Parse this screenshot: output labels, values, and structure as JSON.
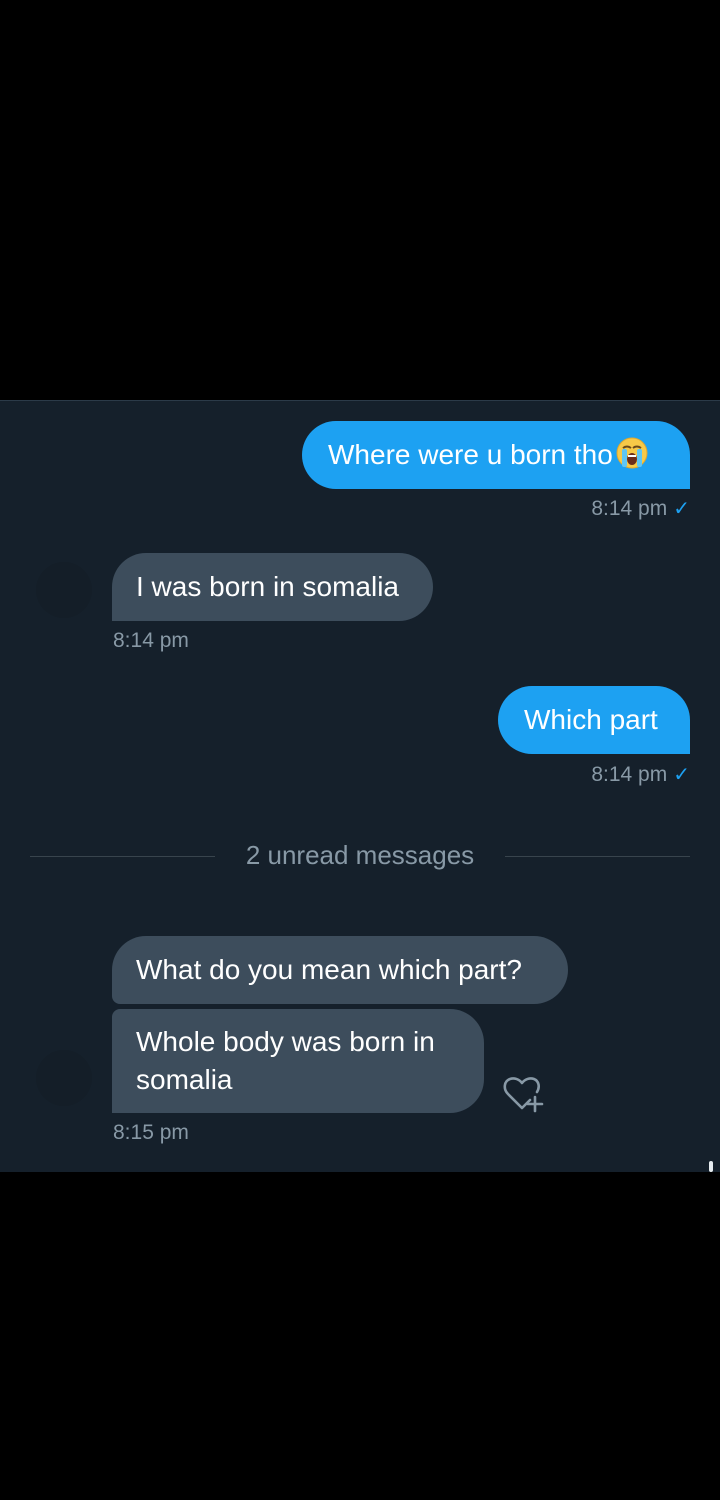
{
  "messages": [
    {
      "direction": "outgoing",
      "text": "Where were u born tho",
      "emoji": "loudly-crying-face",
      "time": "8:14 pm",
      "read": true
    },
    {
      "direction": "incoming",
      "text": "I was born in somalia",
      "time": "8:14 pm"
    },
    {
      "direction": "outgoing",
      "text": "Which part",
      "time": "8:14 pm",
      "read": true
    },
    {
      "direction": "incoming",
      "text": "What do you mean which part?"
    },
    {
      "direction": "incoming",
      "text": "Whole body was born in somalia",
      "time": "8:15 pm"
    }
  ],
  "unread_divider": "2 unread messages",
  "read_check": "✓",
  "icons": {
    "reaction": "heart-add-icon",
    "emoji": "loudly-crying-face-emoji"
  },
  "colors": {
    "chat_background": "#15202b",
    "outgoing_bubble": "#1da1f2",
    "incoming_bubble": "#3d4d5c",
    "timestamp": "#8899a6",
    "divider_line": "#38444d"
  }
}
